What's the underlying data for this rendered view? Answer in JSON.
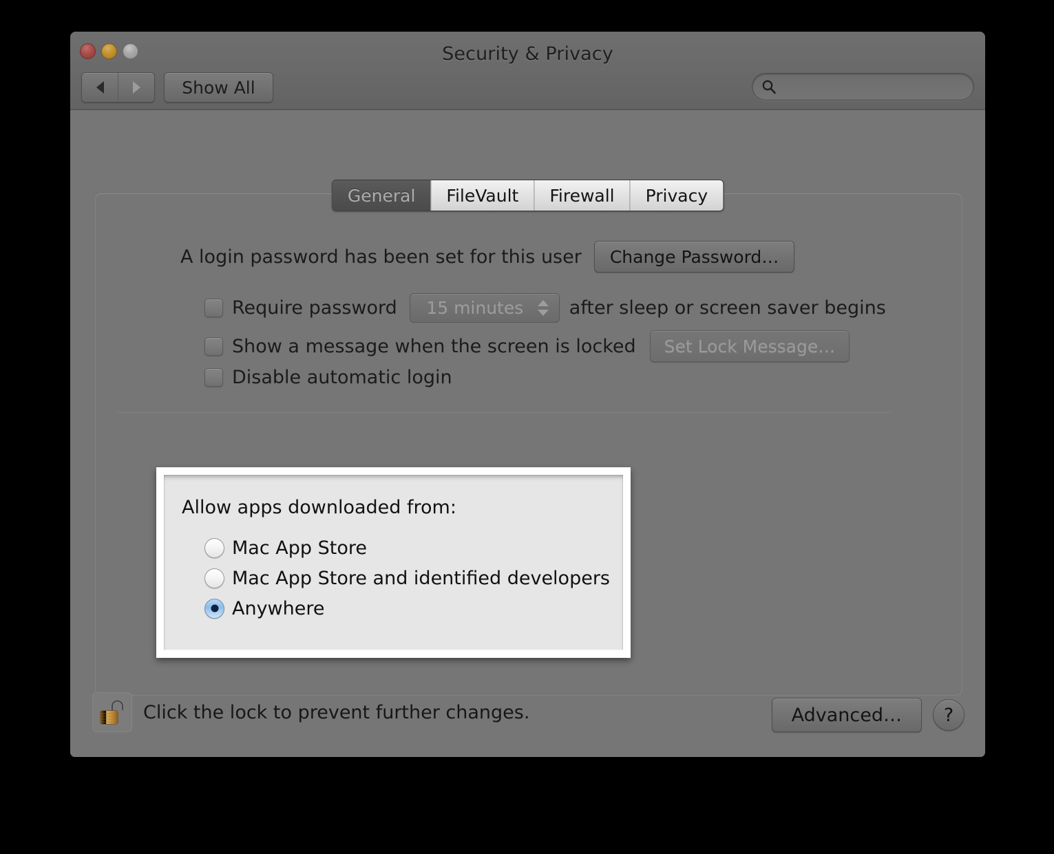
{
  "window": {
    "title": "Security & Privacy",
    "traffic_lights": [
      "close-button",
      "minimize-button",
      "maximize-button"
    ]
  },
  "toolbar": {
    "back_label": "◀",
    "forward_label": "▶",
    "show_all_label": "Show All",
    "search": {
      "value": "",
      "placeholder": ""
    }
  },
  "tabs": [
    {
      "label": "General",
      "active": true
    },
    {
      "label": "FileVault",
      "active": false
    },
    {
      "label": "Firewall",
      "active": false
    },
    {
      "label": "Privacy",
      "active": false
    }
  ],
  "general": {
    "password_status": "A login password has been set for this user",
    "change_password_label": "Change Password…",
    "require_password": {
      "label": "Require password",
      "checked": false,
      "interval_value": "15 minutes",
      "trailing_text": "after sleep or screen saver begins"
    },
    "show_message": {
      "label": "Show a message when the screen is locked",
      "checked": false,
      "button_label": "Set Lock Message…",
      "button_disabled": true
    },
    "disable_auto_login": {
      "label": "Disable automatic login",
      "checked": false
    }
  },
  "gatekeeper": {
    "title": "Allow apps downloaded from:",
    "options": [
      {
        "label": "Mac App Store",
        "selected": false
      },
      {
        "label": "Mac App Store and identified developers",
        "selected": false
      },
      {
        "label": "Anywhere",
        "selected": true
      }
    ]
  },
  "footer": {
    "lock_text": "Click the lock to prevent further changes.",
    "lock_state": "unlocked",
    "advanced_label": "Advanced…",
    "help_label": "?"
  },
  "colors": {
    "window_bg": "#767676",
    "panel_bg": "#e6e6e6",
    "panel_border": "#ffffff",
    "accent_radio": "#8dbde9",
    "lock_gold": "#c08b38"
  }
}
